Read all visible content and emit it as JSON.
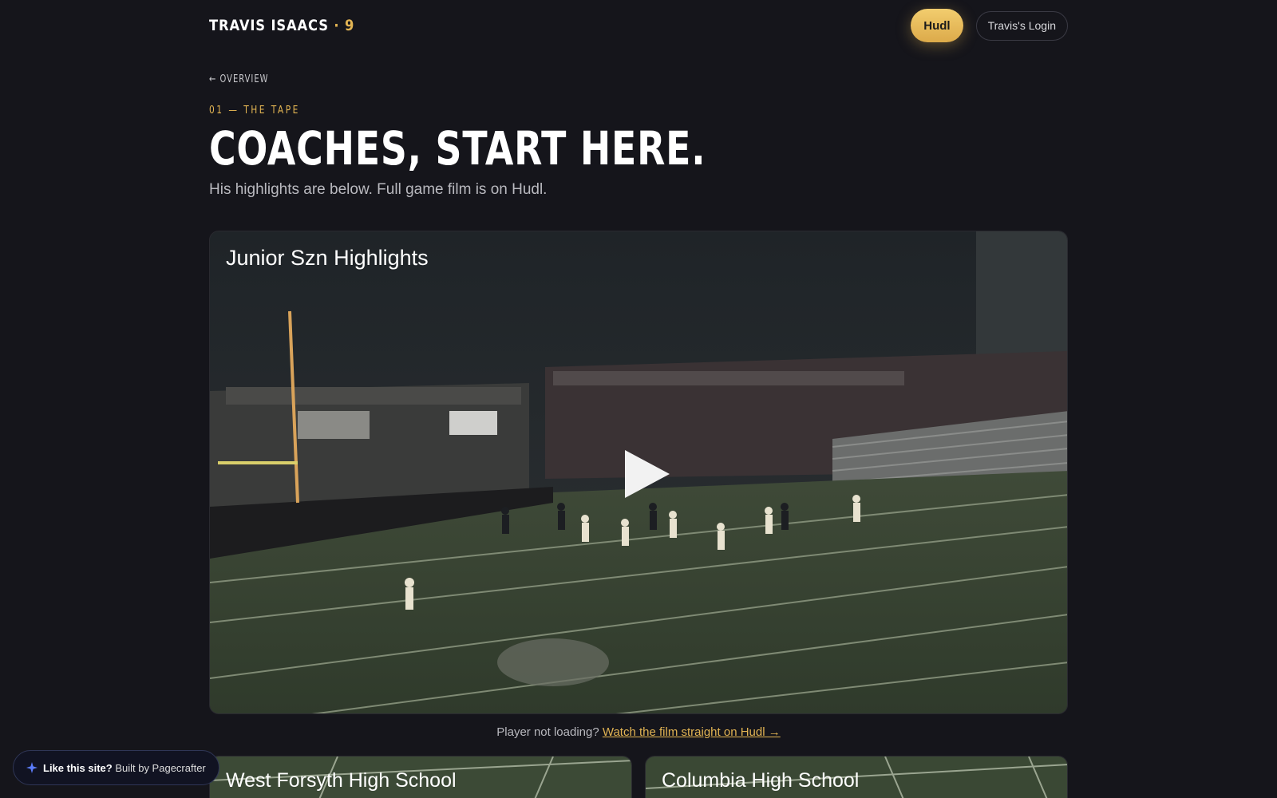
{
  "header": {
    "brand_name": "TRAVIS ISAACS",
    "brand_sep": " · ",
    "brand_number": "9",
    "hudl_button": "Hudl",
    "login_button": "Travis's Login"
  },
  "page": {
    "back_link": "← OVERVIEW",
    "eyebrow": "01 — THE TAPE",
    "title": "COACHES, START HERE.",
    "subtitle": "His highlights are below. Full game film is on Hudl."
  },
  "main_video": {
    "title": "Junior Szn Highlights",
    "play_icon": "play-icon"
  },
  "fallback": {
    "text": "Player not loading? ",
    "link": "Watch the film straight on Hudl →"
  },
  "videos": [
    {
      "title": "West Forsyth High School"
    },
    {
      "title": "Columbia High School"
    }
  ],
  "badge": {
    "icon": "sparkle-icon",
    "strong": "Like this site?",
    "text": " Built by Pagecrafter"
  },
  "colors": {
    "background": "#15151b",
    "accent": "#e2b453",
    "field": "#3c4a33"
  }
}
